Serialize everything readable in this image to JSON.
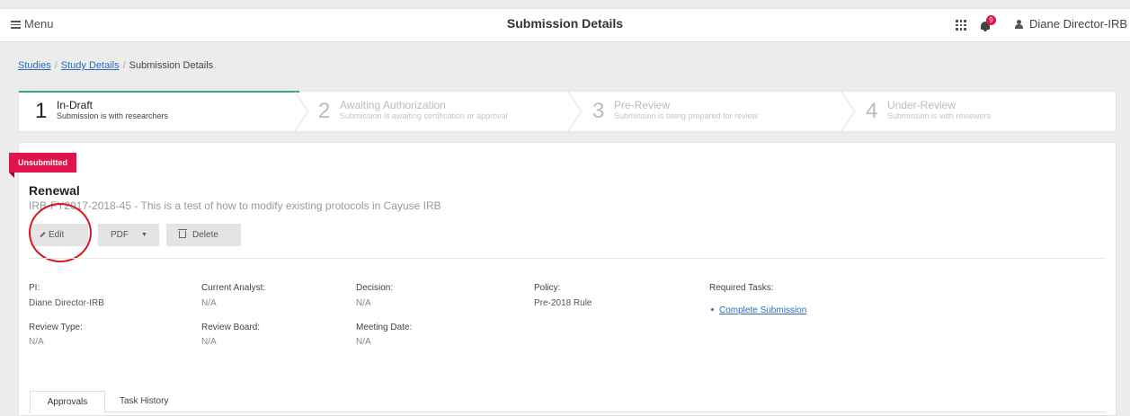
{
  "topbar": {
    "menu_label": "Menu",
    "title": "Submission Details",
    "notification_count": "9",
    "user_name": "Diane Director-IRB"
  },
  "breadcrumb": {
    "items": [
      "Studies",
      "Study Details",
      "Submission Details"
    ],
    "separator": "/"
  },
  "steps": [
    {
      "number": "1",
      "title": "In-Draft",
      "subtitle": "Submission is with researchers",
      "active": true
    },
    {
      "number": "2",
      "title": "Awaiting Authorization",
      "subtitle": "Submission is awaiting certification or approval",
      "active": false
    },
    {
      "number": "3",
      "title": "Pre-Review",
      "subtitle": "Submission is being prepared for review",
      "active": false
    },
    {
      "number": "4",
      "title": "Under-Review",
      "subtitle": "Submission is with reviewers",
      "active": false
    }
  ],
  "submission": {
    "status_badge": "Unsubmitted",
    "title": "Renewal",
    "description": "IRB-FY2017-2018-45 - This is a test of how to modify existing protocols in Cayuse IRB",
    "actions": {
      "edit": "Edit",
      "pdf": "PDF",
      "delete": "Delete"
    }
  },
  "fields": {
    "pi": {
      "label": "PI:",
      "value": "Diane Director-IRB"
    },
    "current_analyst": {
      "label": "Current Analyst:",
      "value": "N/A"
    },
    "decision": {
      "label": "Decision:",
      "value": "N/A"
    },
    "policy": {
      "label": "Policy:",
      "value": "Pre-2018 Rule"
    },
    "review_type": {
      "label": "Review Type:",
      "value": "N/A"
    },
    "review_board": {
      "label": "Review Board:",
      "value": "N/A"
    },
    "meeting_date": {
      "label": "Meeting Date:",
      "value": "N/A"
    },
    "required_tasks": {
      "label": "Required Tasks:",
      "items": [
        "Complete Submission"
      ]
    }
  },
  "tabs": [
    "Approvals",
    "Task History"
  ],
  "colors": {
    "accent_green": "#3aa57a",
    "badge_red": "#e0134a",
    "link_blue": "#2a6ebb",
    "annotation_circle": "#d71920"
  }
}
